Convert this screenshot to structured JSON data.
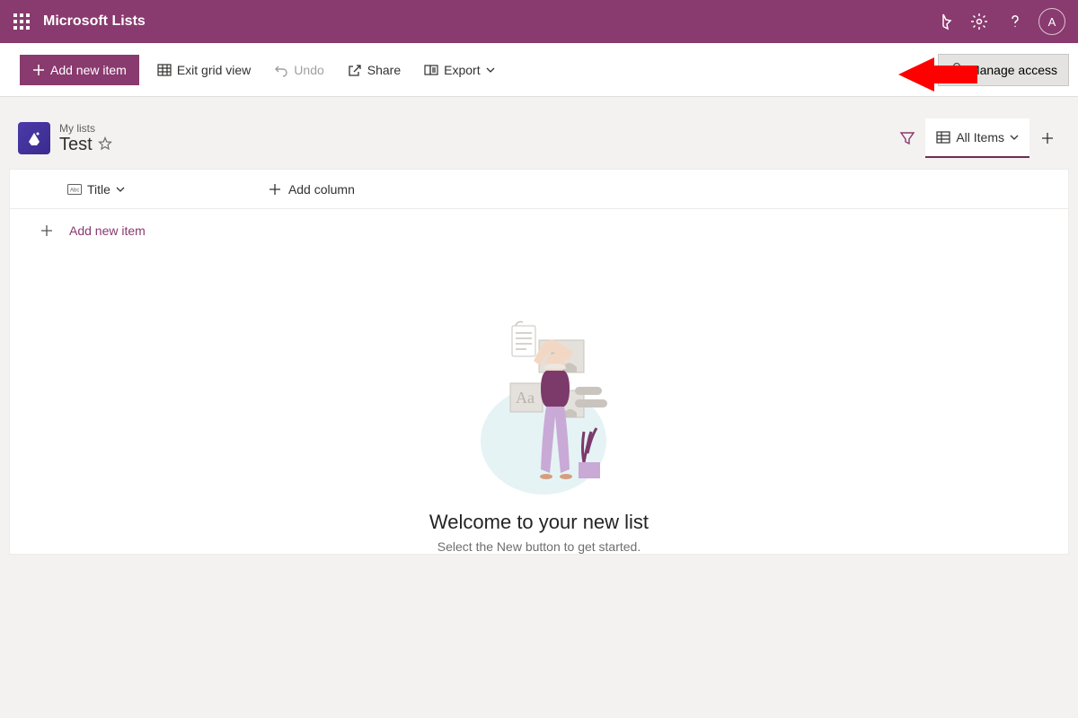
{
  "topbar": {
    "app_name": "Microsoft Lists",
    "avatar_initial": "A"
  },
  "cmdbar": {
    "add_new_item": "Add new item",
    "exit_grid_view": "Exit grid view",
    "undo": "Undo",
    "share": "Share",
    "export": "Export",
    "manage_access": "Manage access"
  },
  "list_header": {
    "breadcrumb": "My lists",
    "title": "Test",
    "view_label": "All Items"
  },
  "columns": {
    "title_col": "Title",
    "add_column": "Add column"
  },
  "add_row_label": "Add new item",
  "empty_state": {
    "title": "Welcome to your new list",
    "subtitle": "Select the New button to get started."
  }
}
